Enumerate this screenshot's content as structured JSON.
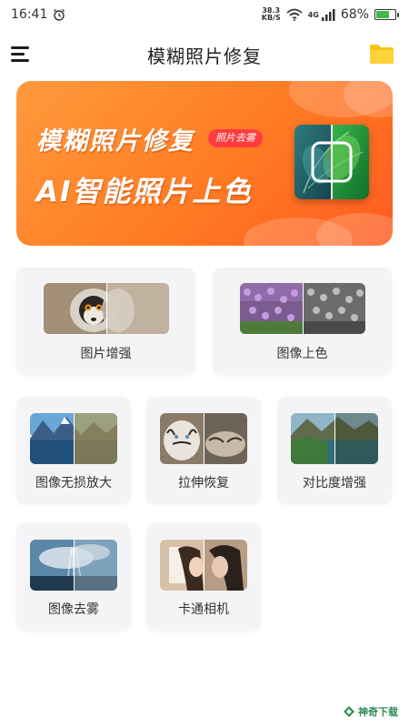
{
  "status_bar": {
    "time": "16:41",
    "net_speed_value": "38.3",
    "net_speed_unit": "KB/S",
    "network_type": "4G",
    "battery_percent": "68%",
    "battery_level": 0.68,
    "icons": [
      "alarm-icon",
      "wifi-icon",
      "signal-icon",
      "battery-icon"
    ]
  },
  "header": {
    "title": "模糊照片修复",
    "menu_icon": "hamburger-menu-icon",
    "folder_icon": "folder-icon"
  },
  "banner": {
    "title_line1": "模糊照片修复",
    "badge": "照片去雾",
    "title_line2": "AI智能照片上色"
  },
  "features": [
    {
      "label": "图片增强"
    },
    {
      "label": "图像上色"
    },
    {
      "label": "图像无损放大"
    },
    {
      "label": "拉伸恢复"
    },
    {
      "label": "对比度增强"
    },
    {
      "label": "图像去雾"
    },
    {
      "label": "卡通相机"
    }
  ],
  "watermark": {
    "text": "神奇下载"
  },
  "colors": {
    "banner_start": "#ff9a3c",
    "banner_end": "#ff5c20",
    "badge": "#ff3d3d",
    "card_bg": "#f4f4f6",
    "folder": "#f7c21c"
  }
}
